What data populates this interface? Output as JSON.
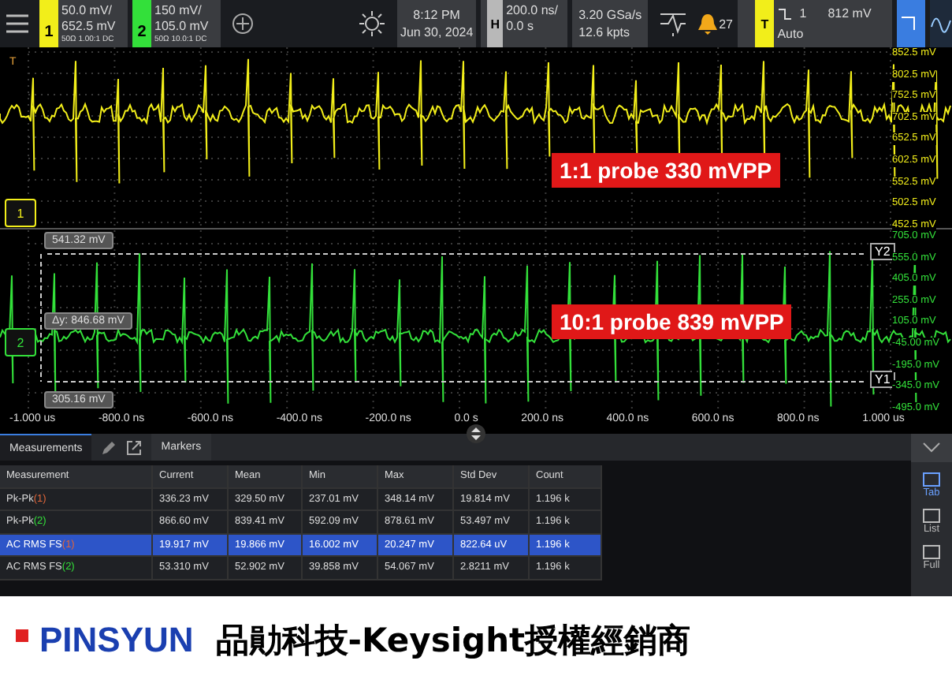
{
  "top_bar": {
    "channels": [
      {
        "number": "1",
        "color": "#f2ee1a",
        "scale": "50.0 mV/",
        "offset": "652.5 mV",
        "coupling": "50Ω 1.00:1 DC"
      },
      {
        "number": "2",
        "color": "#33e03a",
        "scale": "150 mV/",
        "offset": "105.0 mV",
        "coupling": "50Ω 10.0:1 DC"
      }
    ],
    "clock": {
      "time": "8:12 PM",
      "date": "Jun 30, 2024"
    },
    "horizontal": {
      "badge": "H",
      "scale": "200.0 ns/",
      "delay": "0.0 s"
    },
    "acquisition": {
      "rate": "3.20 GSa/s",
      "points": "12.6 kpts"
    },
    "notifications": {
      "count": "27"
    },
    "trigger": {
      "badge": "T",
      "mode": "Auto",
      "source": "1",
      "level": "812 mV"
    }
  },
  "display": {
    "trigger_marker": "T",
    "annotations": [
      "1:1 probe 330 mVPP",
      "10:1 probe 839 mVPP"
    ],
    "channel_markers": [
      {
        "label": "1",
        "color": "#f2ee1a"
      },
      {
        "label": "2",
        "color": "#33e03a"
      }
    ],
    "cursor_readouts": [
      "541.32 mV",
      "Δy: 846.68 mV",
      "305.16 mV"
    ],
    "cursor_tags": [
      "Y2",
      "Y1"
    ],
    "axes": [
      {
        "color": "#f2ee1a",
        "labels": [
          "852.5 mV",
          "802.5 mV",
          "752.5 mV",
          "702.5 mV",
          "652.5 mV",
          "602.5 mV",
          "552.5 mV",
          "502.5 mV",
          "452.5 mV"
        ]
      },
      {
        "color": "#33e03a",
        "labels": [
          "705.0 mV",
          "555.0 mV",
          "405.0 mV",
          "255.0 mV",
          "105.0 mV",
          "-45.00 mV",
          "-195.0 mV",
          "-345.0 mV",
          "-495.0 mV"
        ]
      }
    ],
    "time_labels": [
      "-1.000 us",
      "-800.0 ns",
      "-600.0 ns",
      "-400.0 ns",
      "-200.0 ns",
      "0.0 s",
      "200.0 ns",
      "400.0 ns",
      "600.0 ns",
      "800.0 ns",
      "1.000 us"
    ]
  },
  "panel": {
    "tabs": [
      {
        "label": "Measurements",
        "selected": true
      },
      {
        "label": "Markers",
        "selected": false
      }
    ],
    "columns": [
      "Measurement",
      "Current",
      "Mean",
      "Min",
      "Max",
      "Std Dev",
      "Count"
    ],
    "rows": [
      {
        "name": "Pk-Pk",
        "source": "(1)",
        "color": "#e0663a",
        "values": [
          "336.23 mV",
          "329.50 mV",
          "237.01 mV",
          "348.14 mV",
          "19.814 mV",
          "1.196 k"
        ],
        "selected": false
      },
      {
        "name": "Pk-Pk",
        "source": "(2)",
        "color": "#33e03a",
        "values": [
          "866.60 mV",
          "839.41 mV",
          "592.09 mV",
          "878.61 mV",
          "53.497 mV",
          "1.196 k"
        ],
        "selected": false
      },
      {
        "name": "AC RMS FS",
        "source": "(1)",
        "color": "#e0663a",
        "values": [
          "19.917 mV",
          "19.866 mV",
          "16.002 mV",
          "20.247 mV",
          "822.64 uV",
          "1.196 k"
        ],
        "selected": true
      },
      {
        "name": "AC RMS FS",
        "source": "(2)",
        "color": "#33e03a",
        "values": [
          "53.310 mV",
          "52.902 mV",
          "39.858 mV",
          "54.067 mV",
          "2.8211 mV",
          "1.196 k"
        ],
        "selected": false
      }
    ],
    "view_buttons": [
      {
        "label": "Tab",
        "selected": true
      },
      {
        "label": "List",
        "selected": false
      },
      {
        "label": "Full",
        "selected": false
      }
    ]
  },
  "banner": {
    "logo": "PINSYUN",
    "tagline": "品勛科技-Keysight授權經銷商"
  }
}
